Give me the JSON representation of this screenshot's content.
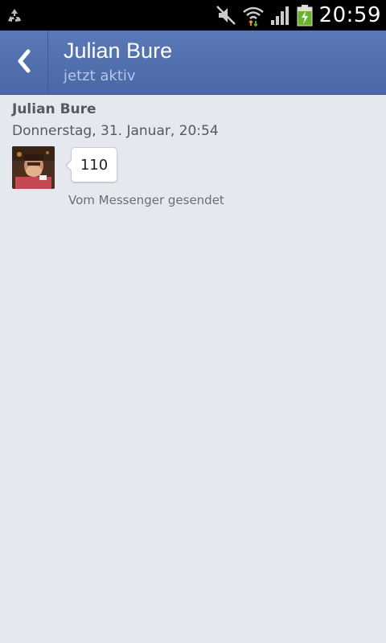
{
  "status_bar": {
    "time": "20:59",
    "icons": [
      "recycle-icon",
      "mute-icon",
      "wifi-icon",
      "signal-icon",
      "battery-charging-icon"
    ]
  },
  "header": {
    "title": "Julian Bure",
    "subtitle": "jetzt aktiv"
  },
  "conversation": {
    "sender_name": "Julian Bure",
    "timestamp": "Donnerstag, 31. Januar, 20:54",
    "message": "110",
    "sent_via": "Vom Messenger gesendet"
  },
  "colors": {
    "action_bar": "#4a67a6",
    "background": "#e5e8ee",
    "subtitle": "#b4c6ea"
  }
}
